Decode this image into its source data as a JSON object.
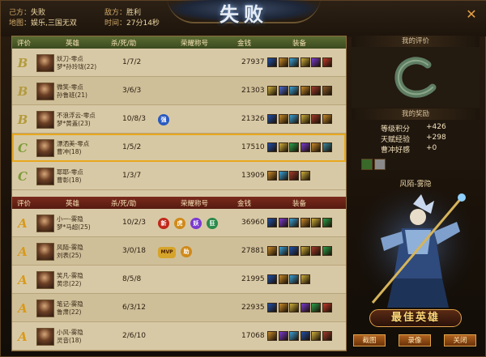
{
  "header": {
    "our_side_label": "己方：",
    "our_side_result": "失败",
    "enemy_side_label": "敌方：",
    "enemy_side_result": "胜利",
    "map_label": "地图：",
    "map_value": "娱乐,三国无双",
    "time_label": "时间：",
    "time_value": "27分14秒",
    "result_title": "失败",
    "close_label": "✕"
  },
  "columns": {
    "rating": "评价",
    "hero": "英雄",
    "kda": "杀/死/助",
    "honor": "荣耀称号",
    "gold": "金钱",
    "gear": "装备"
  },
  "our_team": [
    {
      "rating": "B",
      "name1": "妖刀-零点",
      "name2": "梦*孙玲珑(22)",
      "kda": "1/7/2",
      "gold": "27937",
      "honors": [],
      "items": [
        "#1f4fa8",
        "#c88a2a",
        "#3aa0d8",
        "#d0b03c",
        "#7a3ad0",
        "#c03a2a"
      ]
    },
    {
      "rating": "B",
      "name1": "微笑-零点",
      "name2": "孙鲁班(21)",
      "kda": "3/6/3",
      "gold": "21303",
      "honors": [],
      "items": [
        "#d0b03c",
        "#4a6ad0",
        "#3aa0d8",
        "#c88a2a",
        "#a03a2a",
        "#8a5a2a"
      ]
    },
    {
      "rating": "B",
      "name1": "不浪浮云-零点",
      "name2": "梦*黄盖(23)",
      "kda": "10/8/3",
      "gold": "21326",
      "honors": [
        "强"
      ],
      "items": [
        "#1f4fa8",
        "#c88a2a",
        "#3aa0d8",
        "#d0b03c",
        "#a03a2a",
        "#c88a2a"
      ]
    },
    {
      "rating": "C",
      "name1": "漂洒美-零点",
      "name2": "曹冲(18)",
      "kda": "1/5/2",
      "gold": "17510",
      "honors": [],
      "items": [
        "#1f4fa8",
        "#d0b03c",
        "#2aa04a",
        "#7a3ad0",
        "#c88a2a",
        "#3a8aa0"
      ]
    },
    {
      "rating": "C",
      "name1": "耶耶-零点",
      "name2": "曹彰(18)",
      "kda": "1/3/7",
      "gold": "13909",
      "honors": [],
      "items": [
        "#c88a2a",
        "#3aa0d8",
        "#a03a2a",
        "#d0b03c"
      ]
    }
  ],
  "enemy_team": [
    {
      "rating": "A",
      "name1": "小一-雾隐",
      "name2": "梦*马超(25)",
      "kda": "10/2/3",
      "gold": "36960",
      "honors": [
        "新",
        "虎",
        "妖",
        "狂"
      ],
      "items": [
        "#1f4fa8",
        "#7a3ad0",
        "#3aa0d8",
        "#c88a2a",
        "#d0b03c",
        "#2aa04a"
      ]
    },
    {
      "rating": "A",
      "name1": "风陌-雾隐",
      "name2": "刘表(25)",
      "kda": "3/0/18",
      "gold": "27881",
      "honors": [
        "MVP",
        "助"
      ],
      "items": [
        "#c88a2a",
        "#3aa0d8",
        "#1f4fa8",
        "#d0b03c",
        "#a03a2a",
        "#2aa04a"
      ]
    },
    {
      "rating": "A",
      "name1": "笑凡-雾隐",
      "name2": "黄忠(22)",
      "kda": "8/5/8",
      "gold": "21995",
      "honors": [],
      "items": [
        "#1f4fa8",
        "#c88a2a",
        "#3aa0d8",
        "#d0b03c"
      ]
    },
    {
      "rating": "A",
      "name1": "笔记-雾隐",
      "name2": "鲁肃(22)",
      "kda": "6/3/12",
      "gold": "22935",
      "honors": [],
      "items": [
        "#1f4fa8",
        "#c88a2a",
        "#d0b03c",
        "#7a3ad0",
        "#2aa04a",
        "#c03a2a"
      ]
    },
    {
      "rating": "A",
      "name1": "小风-雾隐",
      "name2": "灵音(18)",
      "kda": "2/6/10",
      "gold": "17068",
      "honors": [],
      "items": [
        "#c88a2a",
        "#7a3ad0",
        "#3aa0d8",
        "#1f4fa8",
        "#d0b03c",
        "#a03a2a"
      ]
    }
  ],
  "my_rating": {
    "title": "我的评价",
    "grade": "C"
  },
  "my_reward": {
    "title": "我的奖励",
    "rows": [
      {
        "label": "等级积分",
        "value": "+426"
      },
      {
        "label": "天赋经验",
        "value": "+298"
      },
      {
        "label": "曹冲好感",
        "value": "+0"
      }
    ]
  },
  "best_hero": {
    "name": "风陌-雾隐",
    "plate": "最佳英雄"
  },
  "buttons": {
    "screenshot": "截图",
    "record": "录像",
    "close": "关闭"
  }
}
